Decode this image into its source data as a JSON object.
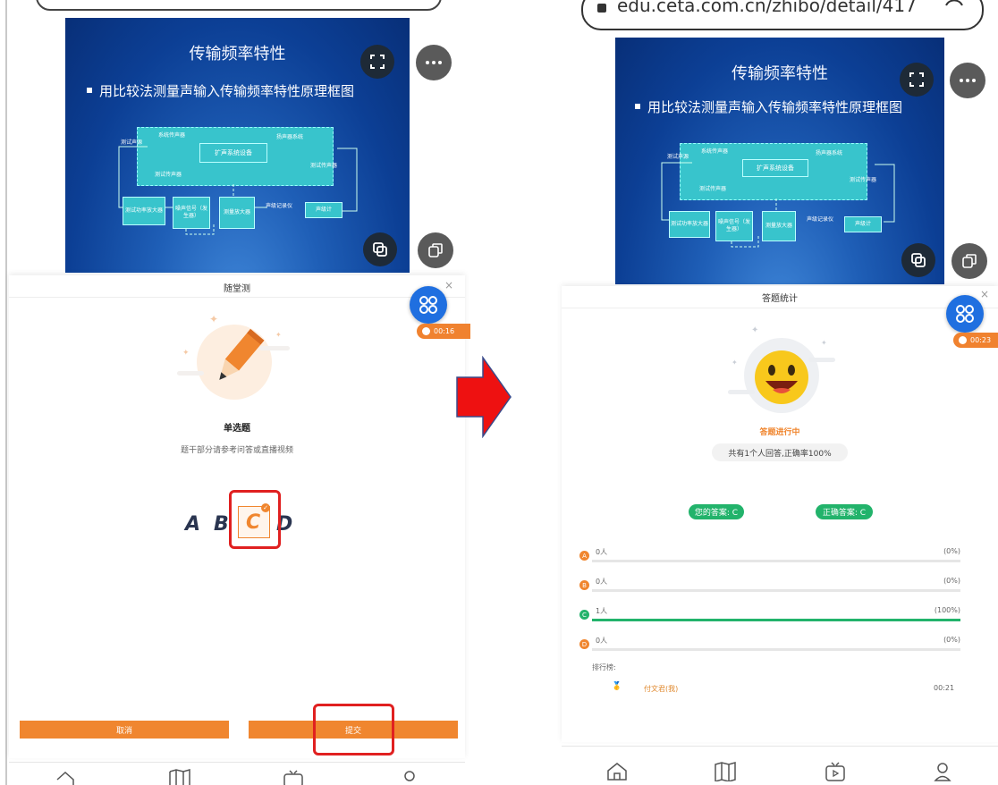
{
  "left": {
    "slide": {
      "title": "传输频率特性",
      "bullet": "用比较法测量声输入传输频率特性原理框图",
      "diagram": {
        "mic_label": "测试声源",
        "sys_mic": "系统传声器",
        "amp_system": "扩声系统设备",
        "speaker_system": "扬声器系统",
        "test_mic_top": "测试传声器",
        "test_mic_bottom": "测试传声器",
        "power_amp": "测试功率放大器",
        "noise_signal": "噪声信号（发生器）",
        "measure_amp": "测量放大器",
        "recorder": "声级记录仪",
        "sound_meter": "声级计"
      }
    },
    "panel": {
      "title": "随堂测",
      "timer": "00:16",
      "question_type": "单选题",
      "question_hint": "题干部分请参考问答或直播视频",
      "choices": [
        "A",
        "B",
        "C",
        "D"
      ],
      "cancel_label": "取消",
      "submit_label": "提交"
    }
  },
  "right": {
    "url": "edu.ceta.com.cn/zhibo/detail/417",
    "slide": {
      "title": "传输频率特性",
      "bullet": "用比较法测量声输入传输频率特性原理框图",
      "diagram": {
        "mic_label": "测试声源",
        "sys_mic": "系统传声器",
        "amp_system": "扩声系统设备",
        "speaker_system": "扬声器系统",
        "test_mic_top": "测试传声器",
        "test_mic_bottom": "测试传声器",
        "power_amp": "测试功率放大器",
        "noise_signal": "噪声信号（发生器）",
        "measure_amp": "测量放大器",
        "recorder": "声级记录仪",
        "sound_meter": "声级计"
      }
    },
    "panel": {
      "title": "答题统计",
      "timer": "00:23",
      "status": "答题进行中",
      "summary": "共有1个人回答,正确率100%",
      "your_answer": "您的答案: C",
      "correct_answer": "正确答案: C",
      "options": [
        {
          "letter": "A",
          "count": "0人",
          "percent": "(0%)",
          "ratio": 0
        },
        {
          "letter": "B",
          "count": "0人",
          "percent": "(0%)",
          "ratio": 0
        },
        {
          "letter": "C",
          "count": "1人",
          "percent": "(100%)",
          "ratio": 1
        },
        {
          "letter": "D",
          "count": "0人",
          "percent": "(0%)",
          "ratio": 0
        }
      ],
      "ranking_label": "排行榜:",
      "ranking": [
        {
          "name": "付文君(我)",
          "time": "00:21"
        }
      ]
    }
  },
  "colors": {
    "accent_orange": "#f0862f",
    "accent_green": "#22b36b",
    "fab_blue": "#1f6fe0",
    "highlight_red": "#e02020",
    "arrow_red": "#ee1111"
  },
  "icons": [
    "fullscreen-icon",
    "more-icon",
    "pip-icon",
    "copy-icon",
    "apps-icon",
    "clock-icon",
    "pencil-icon",
    "smiley-icon",
    "medal-icon",
    "home-icon",
    "book-icon",
    "tv-icon",
    "user-icon",
    "arrow-right-icon",
    "lock-icon",
    "reload-icon"
  ]
}
